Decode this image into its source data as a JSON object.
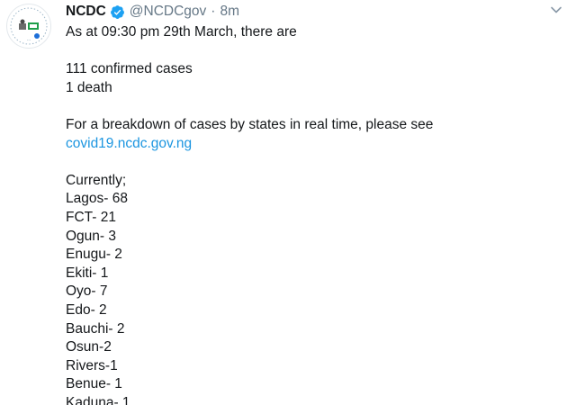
{
  "tweet": {
    "author_name": "NCDC",
    "handle": "@NCDCgov",
    "separator": "·",
    "time": "8m",
    "lines_intro": [
      "As at 09:30 pm 29th March, there are"
    ],
    "stats": [
      "111 confirmed cases",
      "1 death"
    ],
    "breakdown_text": "For a breakdown of cases by states in real time, please see",
    "link_text": "covid19.ncdc.gov.ng",
    "currently_label": "Currently;",
    "states": [
      "Lagos- 68",
      "FCT- 21",
      "Ogun- 3",
      "Enugu- 2",
      "Ekiti- 1",
      "Oyo- 7",
      "Edo- 2",
      "Bauchi- 2",
      "Osun-2",
      "Rivers-1",
      "Benue- 1",
      "Kaduna- 1"
    ]
  },
  "icons": {
    "avatar": "ncdc-logo",
    "verified": "verified-badge-icon",
    "menu": "chevron-down-icon"
  },
  "colors": {
    "text": "#14171a",
    "secondary": "#657786",
    "link": "#1b95e0",
    "verified": "#1da1f2"
  }
}
